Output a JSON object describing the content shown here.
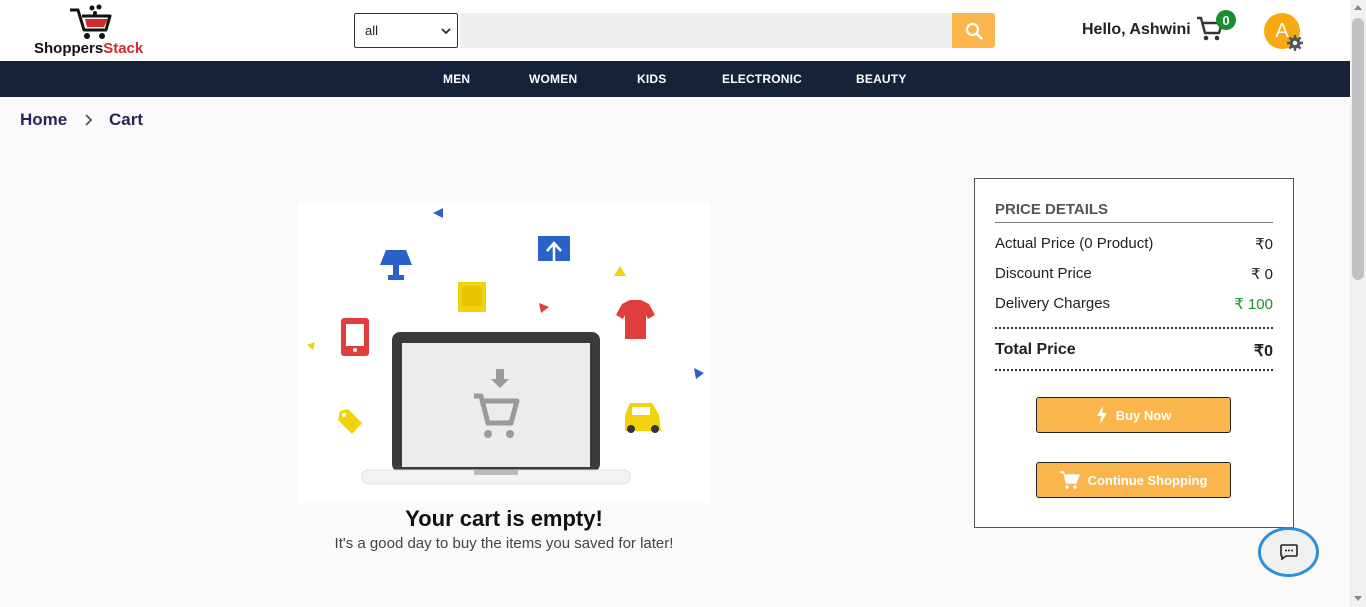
{
  "header": {
    "logo_part1": "Shoppers",
    "logo_part2": "Stack",
    "search_category": "all",
    "search_placeholder": "",
    "greeting": "Hello, Ashwini",
    "cart_count": "0",
    "avatar_letter": "A"
  },
  "nav": {
    "items": [
      "MEN",
      "WOMEN",
      "KIDS",
      "ELECTRONIC",
      "BEAUTY"
    ]
  },
  "breadcrumb": {
    "home": "Home",
    "current": "Cart"
  },
  "empty_cart": {
    "title": "Your cart is empty!",
    "subtitle": "It's a good day to buy the items you saved for later!"
  },
  "price_details": {
    "title": "PRICE DETAILS",
    "actual_label": "Actual Price (0 Product)",
    "actual_value": "₹0",
    "discount_label": "Discount Price",
    "discount_value": "₹ 0",
    "delivery_label": "Delivery Charges",
    "delivery_value": "₹ 100",
    "total_label": "Total Price",
    "total_value": "₹0",
    "buy_now": "Buy Now",
    "continue_shopping": "Continue Shopping"
  },
  "colors": {
    "accent": "#fbb54d",
    "nav_bg": "#15223a",
    "success": "#1b8f2e",
    "brand_red": "#d42a2a"
  }
}
